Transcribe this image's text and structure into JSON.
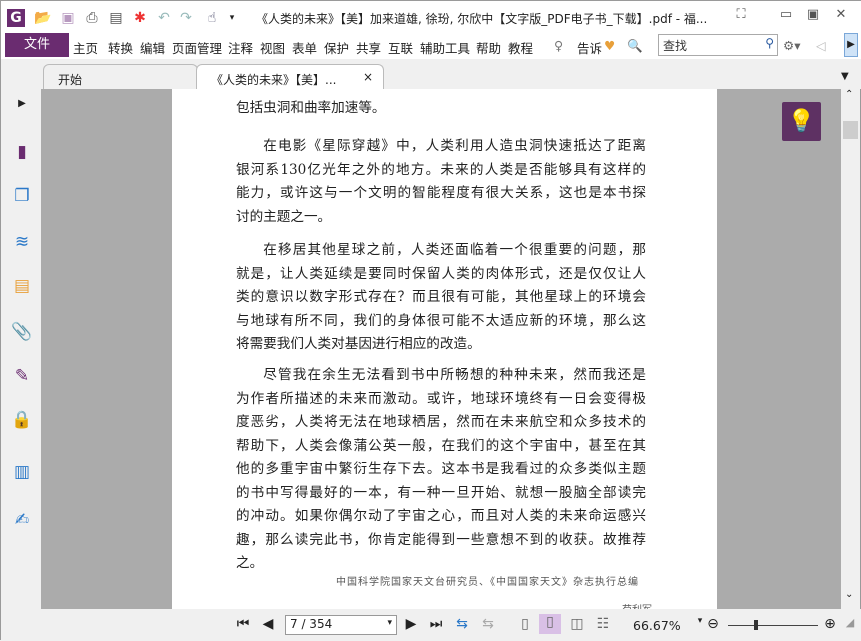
{
  "window": {
    "title": "《人类的未来》【美】加来道雄, 徐玢, 尔欣中【文字版_PDF电子书_下载】.pdf - 福..."
  },
  "quick_access": [
    "app-logo-icon",
    "open-icon",
    "save-icon",
    "print-icon",
    "properties-icon",
    "new-icon",
    "undo-icon",
    "redo-icon",
    "hand-tool-icon"
  ],
  "menu": {
    "file": "文件",
    "items": [
      "主页",
      "转换",
      "编辑",
      "页面管理",
      "注释",
      "视图",
      "表单",
      "保护",
      "共享",
      "互联",
      "辅助工具",
      "帮助",
      "教程"
    ],
    "tell_me": "告诉",
    "search_placeholder": "查找"
  },
  "tabs": [
    {
      "label": "开始"
    },
    {
      "label": "《人类的未来》【美】...",
      "close": "×"
    }
  ],
  "document": {
    "paragraphs": [
      {
        "indent": false,
        "lines": [
          "包括虫洞和曲率加速等。"
        ]
      },
      {
        "indent": true,
        "lines": [
          "在电影《星际穿越》中，人类利用人造虫洞快速抵达了距离",
          "银河系130亿光年之外的地方。未来的人类是否能够具有这样的",
          "能力，或许这与一个文明的智能程度有很大关系，这也是本书探",
          "讨的主题之一。"
        ]
      },
      {
        "indent": true,
        "lines": [
          "在移居其他星球之前，人类还面临着一个很重要的问题，那",
          "就是，让人类延续是要同时保留人类的肉体形式，还是仅仅让人",
          "类的意识以数字形式存在？而且很有可能，其他星球上的环境会",
          "与地球有所不同，我们的身体很可能不太适应新的环境，那么这",
          "将需要我们人类对基因进行相应的改造。"
        ]
      },
      {
        "indent": true,
        "lines": [
          "尽管我在余生无法看到书中所畅想的种种未来，然而我还是",
          "为作者所描述的未来而激动。或许，地球环境终有一日会变得极",
          "度恶劣，人类将无法在地球栖居，然而在未来航空和众多技术的",
          "帮助下，人类会像蒲公英一般，在我们的这个宇宙中，甚至在其",
          "他的多重宇宙中繁衍生存下去。这本书是我看过的众多类似主题",
          "的书中写得最好的一本，有一种一旦开始、就想一股脑全部读完",
          "的冲动。如果你偶尔动了宇宙之心，而且对人类的未来命运感兴",
          "趣，那么读完此书，你肯定能得到一些意想不到的收获。故推荐",
          "之。"
        ]
      }
    ],
    "credit": "中国科学院国家天文台研究员、《中国国家天文》杂志执行总编",
    "credit_name": "苟利军"
  },
  "status": {
    "page": "7 / 354",
    "zoom": "66.67%",
    "zoom_slider_percent": 66.67
  },
  "colors": {
    "accent": "#6a2c70",
    "bulb": "#5e3163"
  }
}
